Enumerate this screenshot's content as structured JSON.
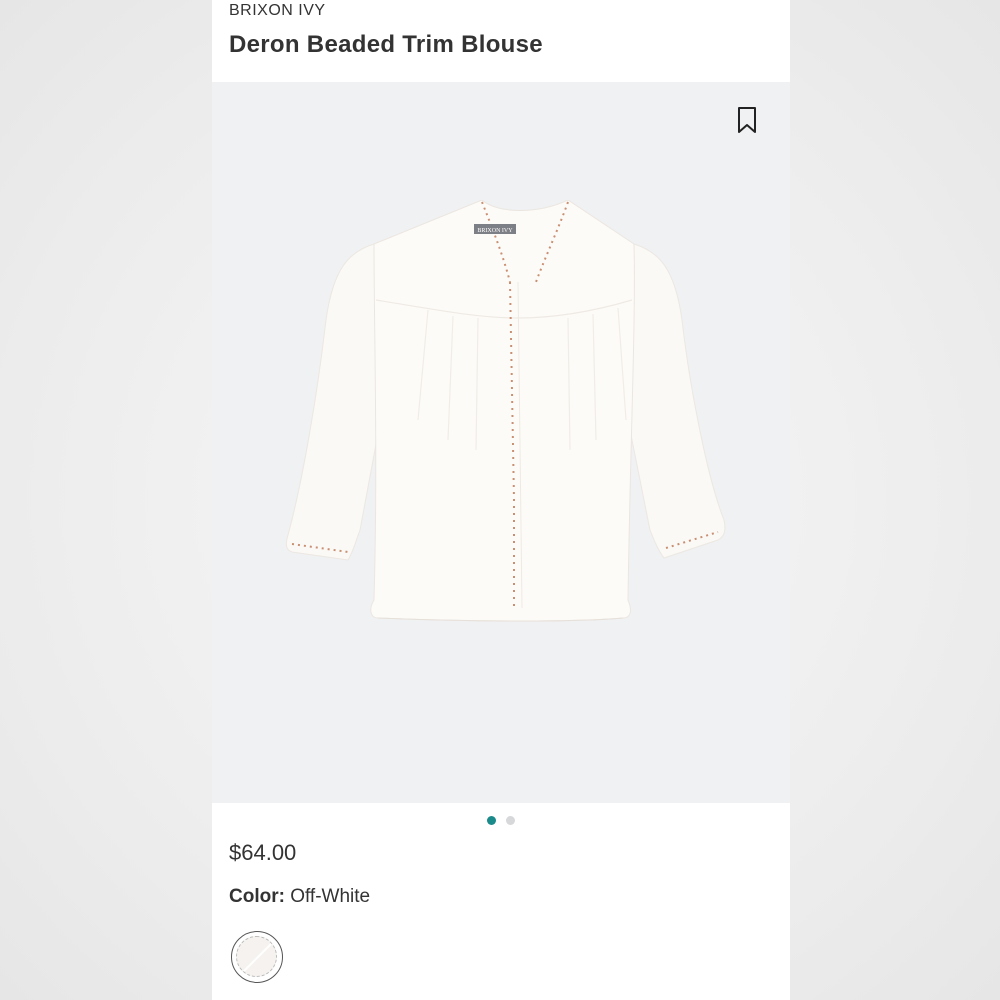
{
  "product": {
    "brand": "BRIXON IVY",
    "name": "Deron Beaded Trim Blouse",
    "price": "$64.00",
    "color_label": "Color:",
    "color_value": "Off-White",
    "image_label": "BRIXON IVY"
  },
  "gallery": {
    "total_images": 2,
    "active_index": 0
  },
  "icons": {
    "bookmark": "bookmark-icon"
  },
  "colors": {
    "accent": "#1a8a8a",
    "trim": "#c98f72",
    "swatch": "#f5f2ef"
  }
}
